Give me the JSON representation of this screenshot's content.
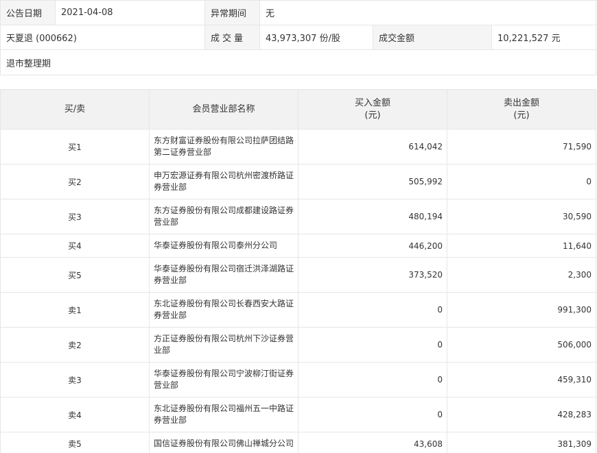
{
  "info": {
    "announce_date_label": "公告日期",
    "announce_date_value": "2021-04-08",
    "abnormal_period_label": "异常期间",
    "abnormal_period_value": "无",
    "stock_name": "天夏退 (000662)",
    "volume_label": "成交量",
    "volume_value": "43,973,307 份/股",
    "amount_label": "成交金额",
    "amount_value": "10,221,527 元",
    "reason": "退市整理期"
  },
  "trades": {
    "headers": {
      "side": "买/卖",
      "broker": "会员营业部名称",
      "buy_amount": "买入金额",
      "buy_unit": "(元)",
      "sell_amount": "卖出金额",
      "sell_unit": "(元)"
    },
    "rows": [
      {
        "side": "买1",
        "broker": "东方财富证券股份有限公司拉萨团结路第二证券营业部",
        "buy": "614,042",
        "sell": "71,590"
      },
      {
        "side": "买2",
        "broker": "申万宏源证券有限公司杭州密渡桥路证券营业部",
        "buy": "505,992",
        "sell": "0"
      },
      {
        "side": "买3",
        "broker": "东方证券股份有限公司成都建设路证券营业部",
        "buy": "480,194",
        "sell": "30,590"
      },
      {
        "side": "买4",
        "broker": "华泰证券股份有限公司泰州分公司",
        "buy": "446,200",
        "sell": "11,640"
      },
      {
        "side": "买5",
        "broker": "华泰证券股份有限公司宿迁洪泽湖路证券营业部",
        "buy": "373,520",
        "sell": "2,300"
      },
      {
        "side": "卖1",
        "broker": "东北证券股份有限公司长春西安大路证券营业部",
        "buy": "0",
        "sell": "991,300"
      },
      {
        "side": "卖2",
        "broker": "方正证券股份有限公司杭州下沙证券营业部",
        "buy": "0",
        "sell": "506,000"
      },
      {
        "side": "卖3",
        "broker": "华泰证券股份有限公司宁波柳汀街证券营业部",
        "buy": "0",
        "sell": "459,310"
      },
      {
        "side": "卖4",
        "broker": "东北证券股份有限公司福州五一中路证券营业部",
        "buy": "0",
        "sell": "428,283"
      },
      {
        "side": "卖5",
        "broker": "国信证券股份有限公司佛山禅城分公司",
        "buy": "43,608",
        "sell": "381,309"
      }
    ]
  }
}
